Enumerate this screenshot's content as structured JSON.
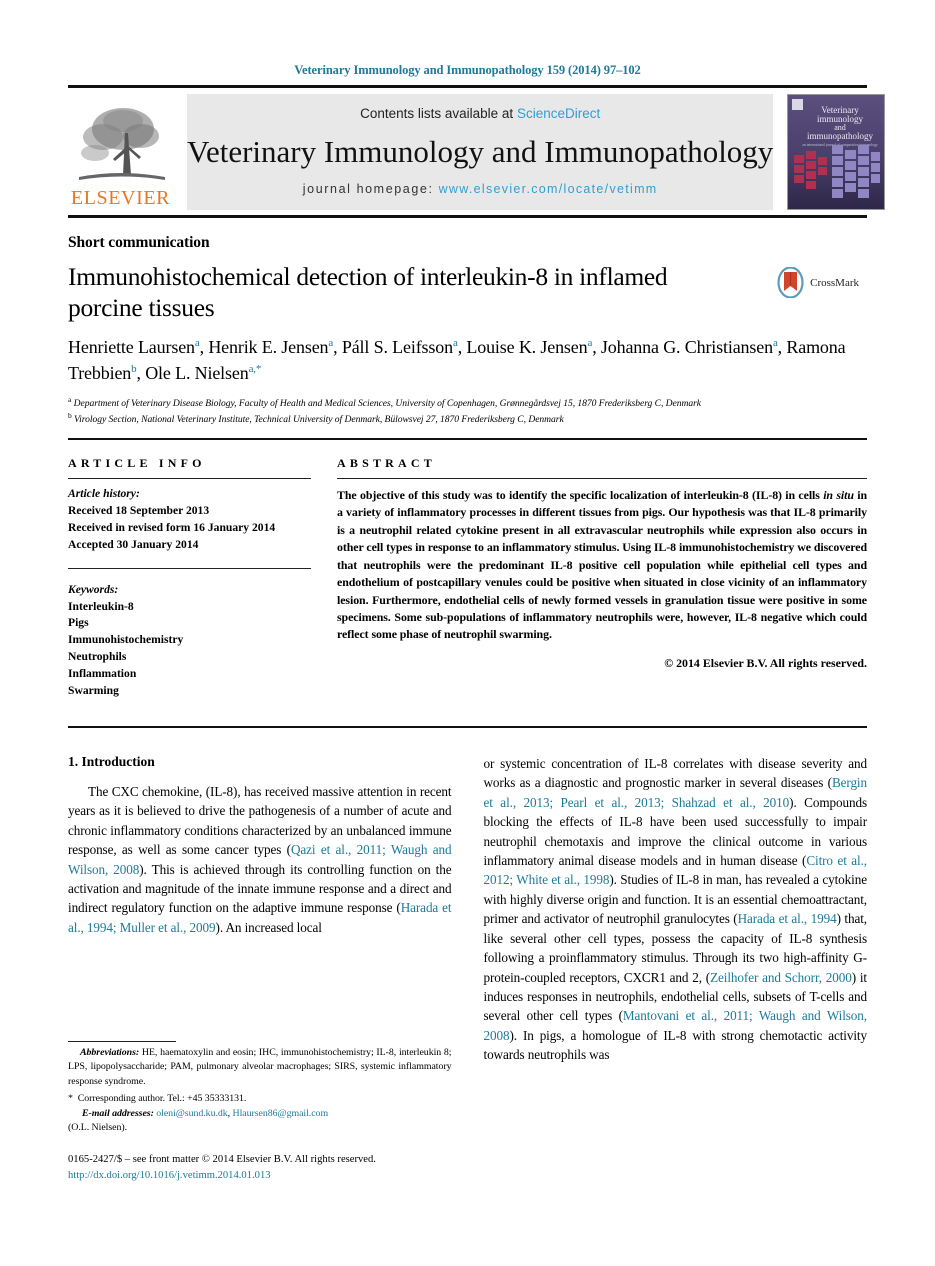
{
  "running_head": "Veterinary Immunology and Immunopathology 159 (2014) 97–102",
  "masthead": {
    "publisher_name": "ELSEVIER",
    "contents_prefix": "Contents lists available at ",
    "contents_link": "ScienceDirect",
    "journal_title": "Veterinary Immunology and Immunopathology",
    "homepage_prefix": "journal homepage:",
    "homepage_url": "www.elsevier.com/locate/vetimm",
    "cover": {
      "line1": "Veterinary",
      "line2": "immunology",
      "line3": "and",
      "line4": "immunopathology",
      "subtitle": "an international journal of comparative immunology"
    }
  },
  "article": {
    "type_label": "Short communication",
    "title": "Immunohistochemical detection of interleukin-8 in inflamed porcine tissues",
    "crossmark_label": "CrossMark",
    "authors": [
      {
        "name": "Henriette Laursen",
        "sup": "a",
        "sep": ", "
      },
      {
        "name": "Henrik E. Jensen",
        "sup": "a",
        "sep": ", "
      },
      {
        "name": "Páll S. Leifsson",
        "sup": "a",
        "sep": ", "
      },
      {
        "name": "Louise K. Jensen",
        "sup": "a",
        "sep": ", "
      },
      {
        "name": "Johanna G. Christiansen",
        "sup": "a",
        "sep": ", "
      },
      {
        "name": "Ramona Trebbien",
        "sup": "b",
        "sep": ", "
      },
      {
        "name": "Ole L. Nielsen",
        "sup": "a,*",
        "sep": ""
      }
    ],
    "affiliations": [
      {
        "marker": "a",
        "text": "Department of Veterinary Disease Biology, Faculty of Health and Medical Sciences, University of Copenhagen, Grønnegårdsvej 15, 1870 Frederiksberg C, Denmark"
      },
      {
        "marker": "b",
        "text": "Virology Section, National Veterinary Institute, Technical University of Denmark, Bülowsvej 27, 1870 Frederiksberg C, Denmark"
      }
    ]
  },
  "article_info": {
    "heading": "ARTICLE INFO",
    "history_label": "Article history:",
    "history": [
      "Received 18 September 2013",
      "Received in revised form 16 January 2014",
      "Accepted 30 January 2014"
    ],
    "keywords_label": "Keywords:",
    "keywords": [
      "Interleukin-8",
      "Pigs",
      "Immunohistochemistry",
      "Neutrophils",
      "Inflammation",
      "Swarming"
    ]
  },
  "abstract": {
    "heading": "ABSTRACT",
    "part1": "The objective of this study was to identify the specific localization of interleukin-8 (IL-8) in cells ",
    "italic1": "in situ",
    "part2": " in a variety of inflammatory processes in different tissues from pigs. Our hypothesis was that IL-8 primarily is a neutrophil related cytokine present in all extravascular neutrophils while expression also occurs in other cell types in response to an inflammatory stimulus. Using IL-8 immunohistochemistry we discovered that neutrophils were the predominant IL-8 positive cell population while epithelial cell types and endothelium of postcapillary venules could be positive when situated in close vicinity of an inflammatory lesion. Furthermore, endothelial cells of newly formed vessels in granulation tissue were positive in some specimens. Some sub-populations of inflammatory neutrophils were, however, IL-8 negative which could reflect some phase of neutrophil swarming.",
    "copyright": "© 2014 Elsevier B.V. All rights reserved."
  },
  "intro": {
    "heading": "1. Introduction",
    "left_p1_a": "The CXC chemokine, (IL-8), has received massive attention in recent years as it is believed to drive the pathogenesis of a number of acute and chronic inflammatory conditions characterized by an unbalanced immune response, as well as some cancer types (",
    "left_ref1": "Qazi et al., 2011; Waugh and Wilson, 2008",
    "left_p1_b": "). This is achieved through its controlling function on the activation and magnitude of the innate immune response and a direct and indirect regulatory function on the adaptive immune response (",
    "left_ref2": "Harada et al., 1994; Muller et al., 2009",
    "left_p1_c": "). An increased local",
    "right_p1_a": "or systemic concentration of IL-8 correlates with disease severity and works as a diagnostic and prognostic marker in several diseases (",
    "right_ref1": "Bergin et al., 2013; Pearl et al., 2013; Shahzad et al., 2010",
    "right_p1_b": "). Compounds blocking the effects of IL-8 have been used successfully to impair neutrophil chemotaxis and improve the clinical outcome in various inflammatory animal disease models and in human disease (",
    "right_ref2": "Citro et al., 2012; White et al., 1998",
    "right_p1_c": "). Studies of IL-8 in man, has revealed a cytokine with highly diverse origin and function. It is an essential chemoattractant, primer and activator of neutrophil granulocytes (",
    "right_ref3": "Harada et al., 1994",
    "right_p1_d": ") that, like several other cell types, possess the capacity of IL-8 synthesis following a proinflammatory stimulus. Through its two high-affinity G-protein-coupled receptors, CXCR1 and 2, (",
    "right_ref4": "Zeilhofer and Schorr, 2000",
    "right_p1_e": ") it induces responses in neutrophils, endothelial cells, subsets of T-cells and several other cell types (",
    "right_ref5": "Mantovani et al., 2011; Waugh and Wilson, 2008",
    "right_p1_f": "). In pigs, a homologue of IL-8 with strong chemotactic activity towards neutrophils was"
  },
  "footnotes": {
    "abbrev_label": "Abbreviations:",
    "abbrev_text": " HE, haematoxylin and eosin; IHC, immunohistochemistry; IL-8, interleukin 8; LPS, lipopolysaccharide; PAM, pulmonary alveolar macrophages; SIRS, systemic inflammatory response syndrome.",
    "corresponding_marker": "*",
    "corresponding_text": "Corresponding author. Tel.: +45 35333131.",
    "email_label": "E-mail addresses:",
    "email1": "oleni@sund.ku.dk",
    "email_sep": ", ",
    "email2": "Hlaursen86@gmail.com",
    "email_owner": "(O.L. Nielsen).",
    "issn_line": "0165-2427/$ – see front matter © 2014 Elsevier B.V. All rights reserved.",
    "doi": "http://dx.doi.org/10.1016/j.vetimm.2014.01.013"
  },
  "colors": {
    "link": "#1d7a99",
    "sciencedirect": "#2f9fd0",
    "elsevier_orange": "#E87722",
    "banner_bg": "#e8e8e8"
  }
}
